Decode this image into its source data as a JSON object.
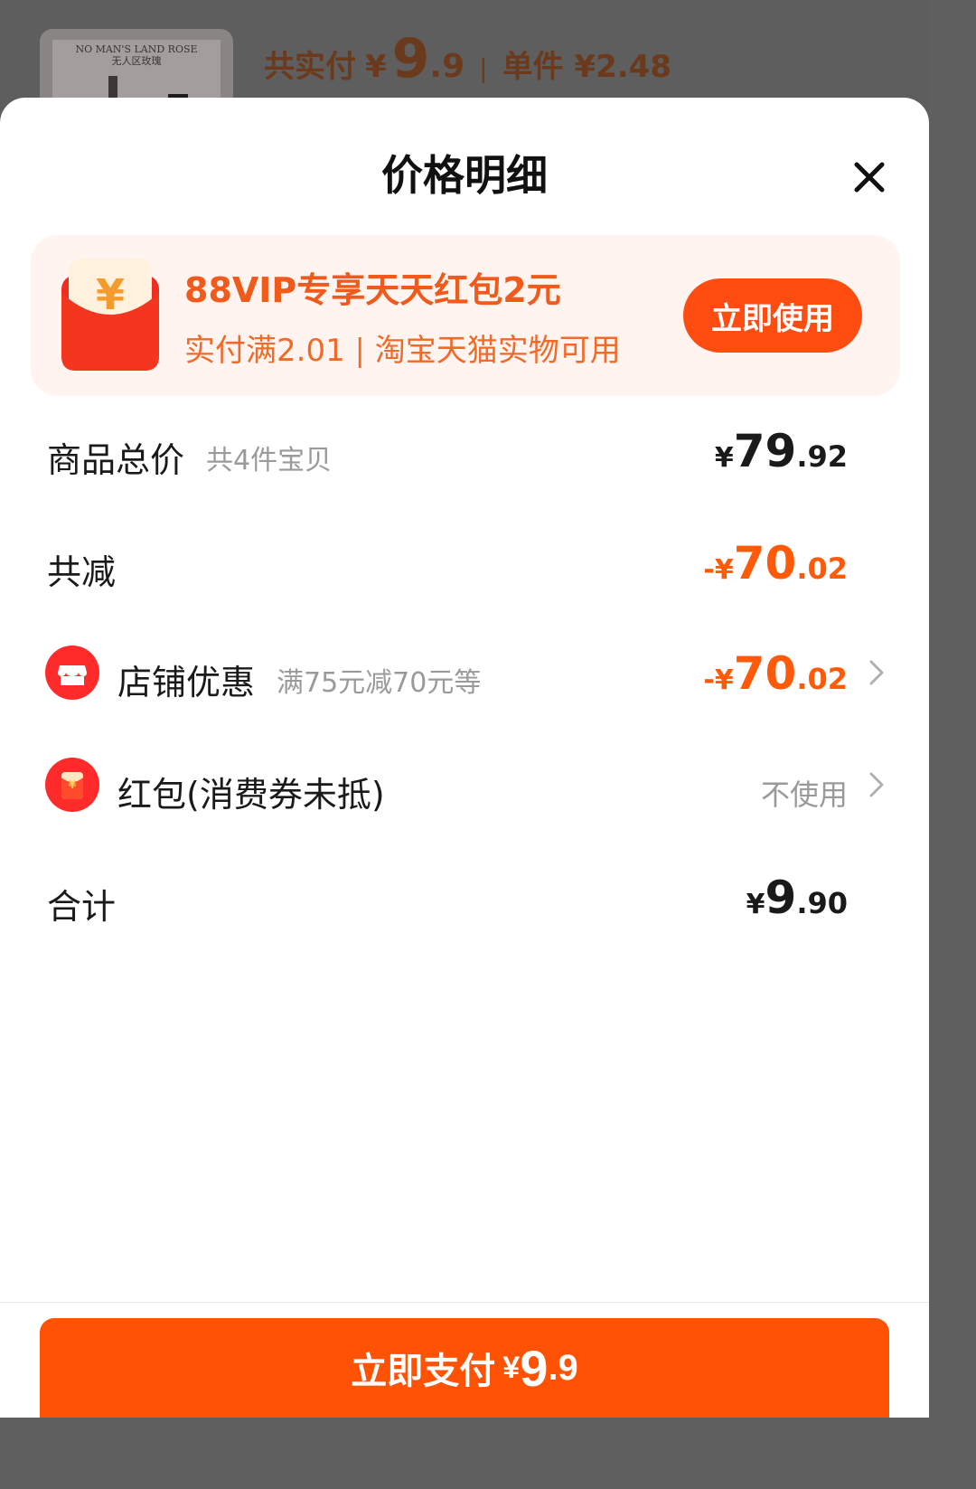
{
  "background": {
    "product_thumb_text": [
      "NO MAN'S LAND ROSE",
      "无人区玫瑰"
    ],
    "paid_label": "共实付",
    "paid_yen": "¥",
    "paid_int": "9",
    "paid_dec": ".9",
    "unit_label": "单件 ¥2.48"
  },
  "sheet": {
    "title": "价格明细",
    "close_icon": "close-icon"
  },
  "promo": {
    "icon": "red-envelope-icon",
    "title": "88VIP专享天天红包2元",
    "subtitle": "实付满2.01 | 淘宝天猫实物可用",
    "button": "立即使用"
  },
  "rows": {
    "total": {
      "label": "商品总价",
      "hint": "共4件宝贝",
      "prefix": "¥",
      "int": "79",
      "dec": ".92"
    },
    "discount": {
      "label": "共减",
      "prefix": "-¥",
      "int": "70",
      "dec": ".02"
    },
    "store": {
      "icon": "store-icon",
      "label": "店铺优惠",
      "hint": "满75元减70元等",
      "prefix": "-¥",
      "int": "70",
      "dec": ".02"
    },
    "redpacket": {
      "icon": "red-packet-icon",
      "label": "红包(消费券未抵)",
      "value": "不使用"
    },
    "sum": {
      "label": "合计",
      "prefix": "¥",
      "int": "9",
      "dec": ".90"
    }
  },
  "footer": {
    "pay_label": "立即支付",
    "pay_yen": "¥",
    "pay_int": "9",
    "pay_dec": ".9"
  },
  "colors": {
    "accent": "#ff5205",
    "promo_text": "#f05a1b",
    "promo_bg": "#fff4ef",
    "discount": "#ff5a0a"
  }
}
